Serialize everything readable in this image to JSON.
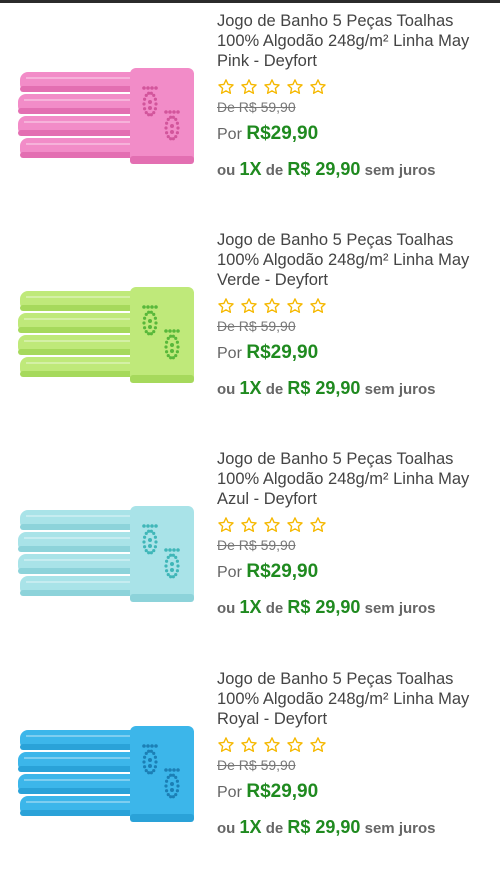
{
  "products": [
    {
      "title": "Jogo de Banho 5 Peças Toalhas 100% Algodão 248g/m² Linha May Pink - Deyfort",
      "rating_stars_filled": 0,
      "rating_stars_total": 5,
      "old_price": "De R$ 59,90",
      "price_prefix": "Por",
      "price": "R$29,90",
      "installment_prefix": "ou",
      "installment_count": "1X",
      "installment_of": "de",
      "installment_amount": "R$ 29,90",
      "installment_suffix": "sem juros",
      "towel_color": "#f28cc8",
      "towel_shade": "#e36fb2",
      "foot_color": "#d2559b"
    },
    {
      "title": "Jogo de Banho 5 Peças Toalhas 100% Algodão 248g/m² Linha May Verde - Deyfort",
      "rating_stars_filled": 0,
      "rating_stars_total": 5,
      "old_price": "De R$ 59,90",
      "price_prefix": "Por",
      "price": "R$29,90",
      "installment_prefix": "ou",
      "installment_count": "1X",
      "installment_of": "de",
      "installment_amount": "R$ 29,90",
      "installment_suffix": "sem juros",
      "towel_color": "#bfe97a",
      "towel_shade": "#a6d95c",
      "foot_color": "#58b83a"
    },
    {
      "title": "Jogo de Banho 5 Peças Toalhas 100% Algodão 248g/m² Linha May Azul - Deyfort",
      "rating_stars_filled": 0,
      "rating_stars_total": 5,
      "old_price": "De R$ 59,90",
      "price_prefix": "Por",
      "price": "R$29,90",
      "installment_prefix": "ou",
      "installment_count": "1X",
      "installment_of": "de",
      "installment_amount": "R$ 29,90",
      "installment_suffix": "sem juros",
      "towel_color": "#a9e3e8",
      "towel_shade": "#8dd3da",
      "foot_color": "#3fb6b8"
    },
    {
      "title": "Jogo de Banho 5 Peças Toalhas 100% Algodão 248g/m² Linha May Royal - Deyfort",
      "rating_stars_filled": 0,
      "rating_stars_total": 5,
      "old_price": "De R$ 59,90",
      "price_prefix": "Por",
      "price": "R$29,90",
      "installment_prefix": "ou",
      "installment_count": "1X",
      "installment_of": "de",
      "installment_amount": "R$ 29,90",
      "installment_suffix": "sem juros",
      "towel_color": "#3cb6ea",
      "towel_shade": "#2aa2d8",
      "foot_color": "#1b7fb5"
    }
  ],
  "colors": {
    "price_green": "#1f8a1f",
    "star_outline": "#f5b800",
    "text_gray": "#444444"
  },
  "icons": {
    "rating_star": "star-outline-icon"
  }
}
